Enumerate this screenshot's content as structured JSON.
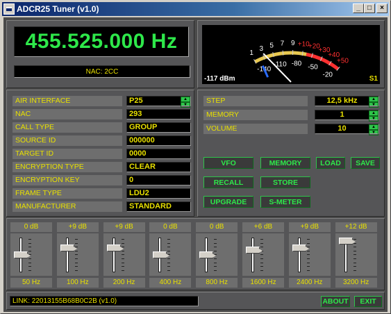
{
  "window": {
    "title": "ADCR25 Tuner (v1.0)",
    "min_glyph": "_",
    "max_glyph": "□",
    "close_glyph": "×"
  },
  "frequency": {
    "display": "455.525.000 Hz",
    "nac_line": "NAC: 2CC"
  },
  "meter": {
    "scale_top": [
      "1",
      "3",
      "5",
      "7",
      "9",
      "+10",
      "+20",
      "+30",
      "+40",
      "+50"
    ],
    "scale_bottom": [
      "-140",
      "-110",
      "-80",
      "-50",
      "-20"
    ],
    "dbm": "-117 dBm",
    "s_reading": "S1",
    "needle_fraction": 0.12
  },
  "params": [
    {
      "label": "AIR INTERFACE",
      "value": "P25",
      "spin": true
    },
    {
      "label": "NAC",
      "value": "293",
      "spin": false
    },
    {
      "label": "CALL TYPE",
      "value": "GROUP",
      "spin": false
    },
    {
      "label": "SOURCE ID",
      "value": "000000",
      "spin": false
    },
    {
      "label": "TARGET ID",
      "value": "0000",
      "spin": false
    },
    {
      "label": "ENCRYPTION TYPE",
      "value": "CLEAR",
      "spin": false
    },
    {
      "label": "ENCRYPTION KEY",
      "value": "0",
      "spin": false
    },
    {
      "label": "FRAME TYPE",
      "value": "LDU2",
      "spin": false
    },
    {
      "label": "MANUFACTURER",
      "value": "STANDARD",
      "spin": false
    }
  ],
  "controls": [
    {
      "label": "STEP",
      "value": "12,5 kHz"
    },
    {
      "label": "MEMORY",
      "value": "1"
    },
    {
      "label": "VOLUME",
      "value": "10"
    }
  ],
  "buttons": {
    "vfo": "VFO",
    "memory": "MEMORY",
    "load": "LOAD",
    "save": "SAVE",
    "recall": "RECALL",
    "store": "STORE",
    "upgrade": "UPGRADE",
    "smeter": "S-METER",
    "about": "ABOUT",
    "exit": "EXIT"
  },
  "equalizer": [
    {
      "gain": "0 dB",
      "freq": "50 Hz",
      "level": 0.5
    },
    {
      "gain": "+9 dB",
      "freq": "100 Hz",
      "level": 0.75
    },
    {
      "gain": "+9 dB",
      "freq": "200 Hz",
      "level": 0.75
    },
    {
      "gain": "0 dB",
      "freq": "400 Hz",
      "level": 0.5
    },
    {
      "gain": "0 dB",
      "freq": "800 Hz",
      "level": 0.5
    },
    {
      "gain": "+6 dB",
      "freq": "1600 Hz",
      "level": 0.67
    },
    {
      "gain": "+9 dB",
      "freq": "2400 Hz",
      "level": 0.75
    },
    {
      "gain": "+12 dB",
      "freq": "3200 Hz",
      "level": 1.0
    }
  ],
  "status": {
    "link": "LINK: 22013155B68B0C2B (v1.0)"
  },
  "colors": {
    "display_green": "#2ee84a",
    "label_yellow": "#e8e000",
    "panel_gray": "#555557",
    "meter_red": "#ff3030",
    "meter_blue": "#2a6cff"
  }
}
